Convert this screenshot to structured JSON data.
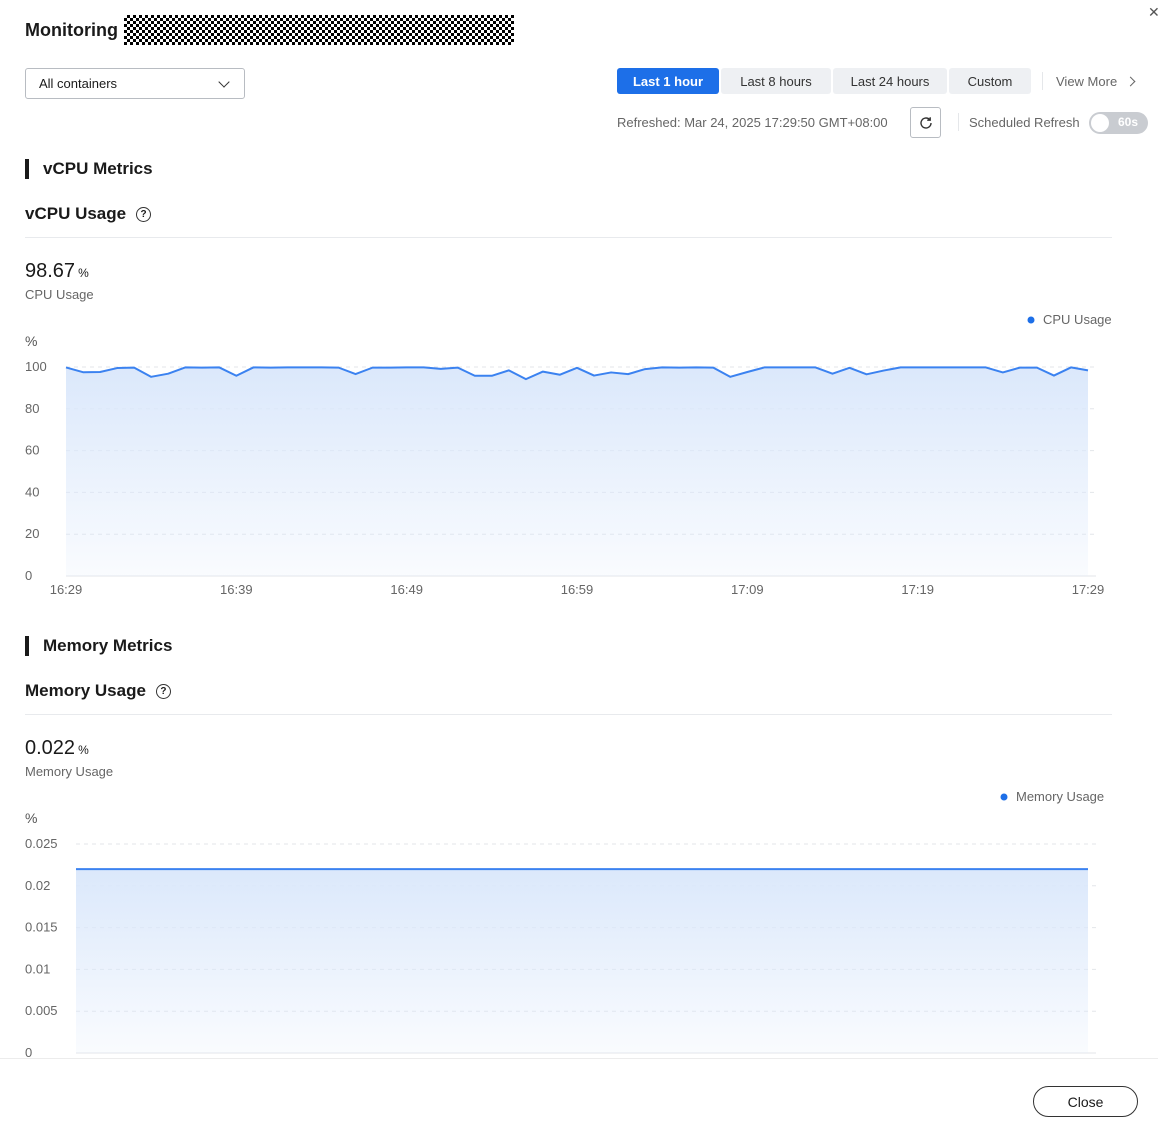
{
  "header": {
    "title": "Monitoring"
  },
  "filter": {
    "selected": "All containers"
  },
  "time_range": {
    "options": [
      "Last 1 hour",
      "Last 8 hours",
      "Last 24 hours",
      "Custom"
    ],
    "active": "Last 1 hour",
    "view_more": "View More"
  },
  "refresh": {
    "text": "Refreshed: Mar 24, 2025 17:29:50 GMT+08:00",
    "scheduled_label": "Scheduled Refresh",
    "interval": "60s",
    "scheduled_on": false
  },
  "vcpu": {
    "section_title": "vCPU Metrics",
    "sub_title": "vCPU Usage",
    "value": "98.67",
    "unit": "%",
    "value_label": "CPU Usage"
  },
  "memory": {
    "section_title": "Memory Metrics",
    "sub_title": "Memory Usage",
    "value": "0.022",
    "unit": "%",
    "value_label": "Memory Usage"
  },
  "footer": {
    "close_label": "Close"
  },
  "colors": {
    "accent": "#1d6fe8",
    "line": "#3b82f0",
    "area": "#dbe8fb"
  },
  "chart_data": [
    {
      "type": "area",
      "ylabel": "%",
      "ylim": [
        0,
        100
      ],
      "yticks": [
        "100",
        "80",
        "60",
        "40",
        "20",
        "0"
      ],
      "xticks": [
        "16:29",
        "16:39",
        "16:49",
        "16:59",
        "17:09",
        "17:19",
        "17:29"
      ],
      "series": [
        {
          "name": "CPU Usage",
          "values": [
            99.8,
            97.5,
            97.6,
            99.5,
            99.7,
            95.3,
            96.8,
            99.8,
            99.7,
            99.8,
            95.8,
            99.8,
            99.7,
            99.8,
            99.8,
            99.8,
            99.7,
            96.6,
            99.7,
            99.7,
            99.8,
            99.8,
            99.1,
            99.7,
            95.8,
            95.8,
            98.4,
            94.2,
            97.8,
            96.3,
            99.6,
            95.9,
            97.4,
            96.6,
            99.0,
            99.8,
            99.7,
            99.8,
            99.7,
            95.3,
            97.6,
            99.8,
            99.8,
            99.8,
            99.8,
            96.8,
            99.6,
            96.5,
            98.3,
            99.8,
            99.8,
            99.8,
            99.8,
            99.8,
            99.8,
            97.4,
            99.7,
            99.7,
            95.9,
            99.8,
            98.4
          ]
        }
      ]
    },
    {
      "type": "area",
      "ylabel": "%",
      "ylim": [
        0,
        0.025
      ],
      "yticks": [
        "0.025",
        "0.02",
        "0.015",
        "0.01",
        "0.005",
        "0"
      ],
      "series": [
        {
          "name": "Memory Usage",
          "values": [
            0.022,
            0.022
          ]
        }
      ]
    }
  ]
}
